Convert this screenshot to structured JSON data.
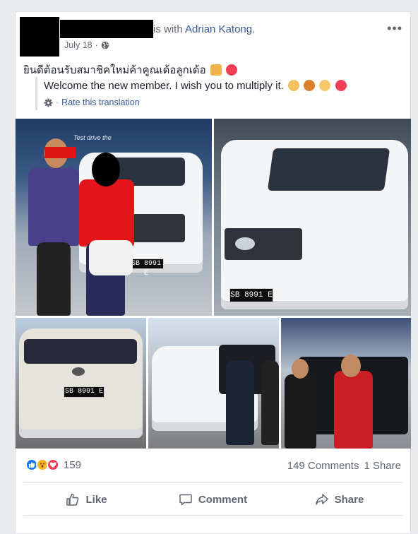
{
  "post": {
    "with_text": "is with",
    "tagged_name": "Adrian Katong.",
    "date": "July 18",
    "date_sep": "·",
    "body_text": "ยินดีต้อนรับสมาชิคใหม่ค้าคูณเด้อลูกเด้อ",
    "translation": "Welcome the new member. I wish you to multiply it.",
    "rate_sep": "·",
    "rate_label": "Rate this translation",
    "more_label": "•••"
  },
  "photos": {
    "plate_text": "SB 8991 E",
    "banner_text": "Test drive the"
  },
  "reactions": {
    "count": "159",
    "comments": "149 Comments",
    "shares": "1 Share"
  },
  "actions": {
    "like": "Like",
    "comment": "Comment",
    "share": "Share"
  },
  "colors": {
    "link": "#385898",
    "like_blue": "#1877f2",
    "wow_yellow": "#f7b125",
    "love_red": "#f33e58"
  }
}
